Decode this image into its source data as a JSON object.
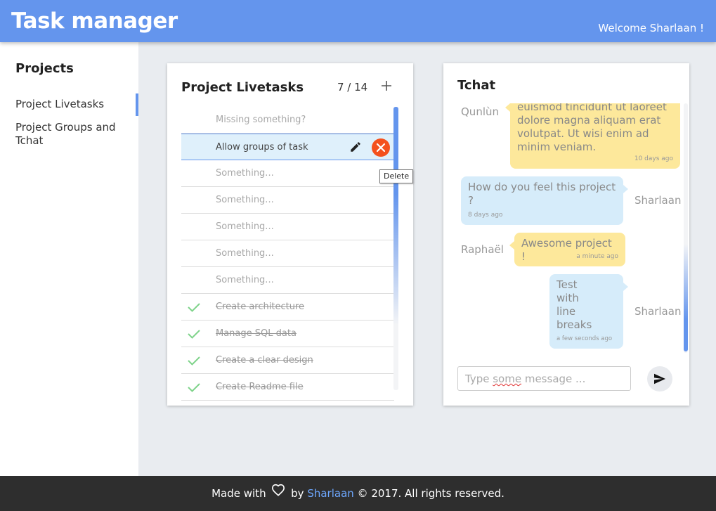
{
  "header": {
    "app_title": "Task manager",
    "welcome": "Welcome Sharlaan !"
  },
  "sidebar": {
    "title": "Projects",
    "items": [
      {
        "label": "Project Livetasks",
        "active": true
      },
      {
        "label": "Project Groups and Tchat",
        "active": false
      }
    ]
  },
  "tasks": {
    "title": "Project Livetasks",
    "counter": "7 / 14",
    "add_label": "+",
    "items": [
      {
        "text": "Missing something?",
        "state": "placeholder"
      },
      {
        "text": "Allow groups of task",
        "state": "selected"
      },
      {
        "text": "Something...",
        "state": "placeholder"
      },
      {
        "text": "Something...",
        "state": "placeholder"
      },
      {
        "text": "Something...",
        "state": "placeholder"
      },
      {
        "text": "Something...",
        "state": "placeholder"
      },
      {
        "text": "Something...",
        "state": "placeholder"
      },
      {
        "text": "Create architecture",
        "state": "done"
      },
      {
        "text": "Manage SQL data",
        "state": "done"
      },
      {
        "text": "Create a clear design",
        "state": "done"
      },
      {
        "text": "Create Readme file",
        "state": "done"
      }
    ],
    "tooltip": "Delete"
  },
  "tchat": {
    "title": "Tchat",
    "messages": [
      {
        "author": "Qunlùn",
        "side": "left",
        "color": "yellow",
        "text": "euismod tincidunt ut laoreet dolore magna aliquam erat volutpat. Ut wisi enim ad minim veniam.",
        "time": "10 days ago"
      },
      {
        "author": "Sharlaan",
        "side": "right",
        "color": "blue",
        "text": "How do you feel this project ?",
        "time": "8 days ago"
      },
      {
        "author": "Raphaël",
        "side": "left",
        "color": "yellow",
        "text": "Awesome project !",
        "time": "a minute ago"
      },
      {
        "author": "Sharlaan",
        "side": "right",
        "color": "blue",
        "text": "Test with line breaks",
        "time": "a few seconds ago"
      }
    ],
    "input_placeholder_pre": "Type ",
    "input_placeholder_spell": "some",
    "input_placeholder_post": " message ..."
  },
  "footer": {
    "made_with": "Made with",
    "by": "by",
    "author": "Sharlaan",
    "copyright": "© 2017. All rights reserved."
  },
  "colors": {
    "primary": "#6495ed",
    "delete": "#f4511e",
    "done_check": "#7ed38a",
    "bubble_yellow": "#fde89b",
    "bubble_blue": "#d6ecfa"
  },
  "icons": [
    "pencil-icon",
    "close-icon",
    "check-icon",
    "plus-icon",
    "send-icon",
    "heart-icon"
  ]
}
